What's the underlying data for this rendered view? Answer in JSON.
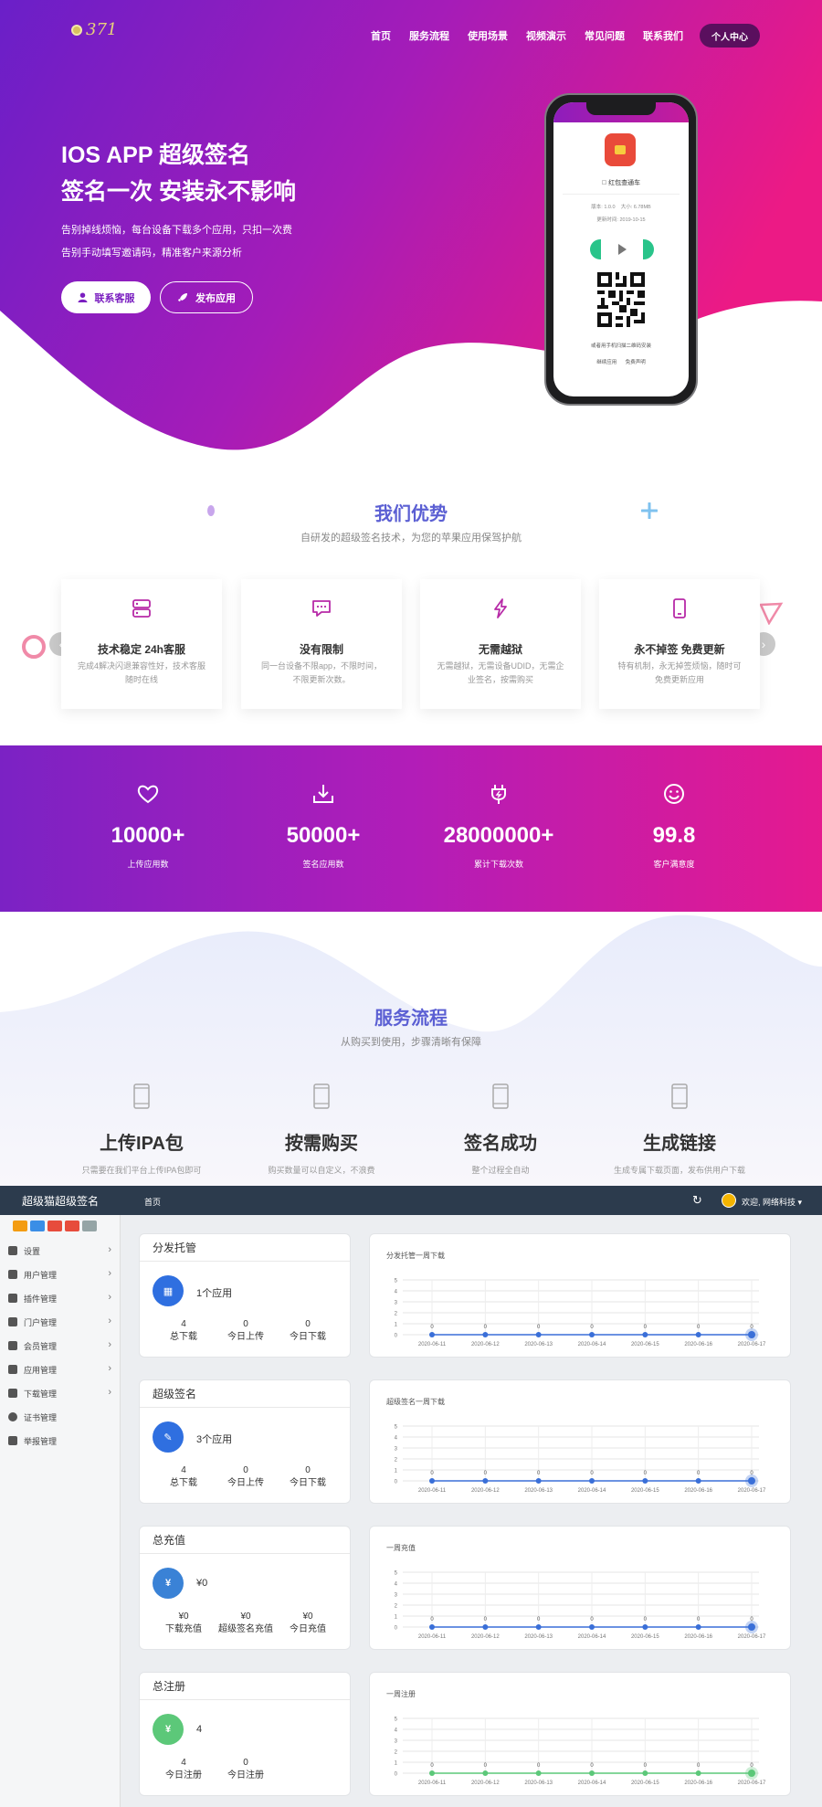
{
  "nav": {
    "logo_text": "371",
    "links": [
      "首页",
      "服务流程",
      "使用场景",
      "视频演示",
      "常见问题",
      "联系我们"
    ],
    "user_center": "个人中心"
  },
  "hero": {
    "title_line1": "IOS APP 超级签名",
    "title_line2": "签名一次 安装永不影响",
    "desc_line1": "告别掉线烦恼，每台设备下载多个应用，只扣一次费",
    "desc_line2": "告别手动填写邀请码，精准客户来源分析",
    "btn_contact": "联系客服",
    "btn_publish": "发布应用"
  },
  "phone": {
    "app_name": "红包查通车",
    "version": "版本: 1.0.0",
    "size": "大小: 6.78MB",
    "updated": "更新时间: 2019-10-15",
    "tip": "或者用手机扫描二维码安装",
    "links": "继续应用 免费声明"
  },
  "advantages": {
    "title": "我们优势",
    "subtitle": "自研发的超级签名技术，为您的苹果应用保驾护航",
    "items": [
      {
        "title": "技术稳定 24h客服",
        "desc": "完成4解决闪退兼容性好，技术客服随时在线"
      },
      {
        "title": "没有限制",
        "desc": "同一台设备不限app，不限时间，不限更新次数。"
      },
      {
        "title": "无需越狱",
        "desc": "无需越狱，无需设备UDID，无需企业签名，按需购买"
      },
      {
        "title": "永不掉签 免费更新",
        "desc": "特有机制，永无掉签烦恼，随时可免费更新应用"
      }
    ]
  },
  "stats": [
    {
      "icon": "heart-icon",
      "value": "10000+",
      "label": "上传应用数"
    },
    {
      "icon": "download-icon",
      "value": "50000+",
      "label": "签名应用数"
    },
    {
      "icon": "plug-icon",
      "value": "28000000+",
      "label": "累计下载次数"
    },
    {
      "icon": "smile-icon",
      "value": "99.8",
      "label": "客户满意度"
    }
  ],
  "flow": {
    "title": "服务流程",
    "subtitle": "从购买到使用，步骤清晰有保障",
    "items": [
      {
        "title": "上传IPA包",
        "desc": "只需要在我们平台上传IPA包即可"
      },
      {
        "title": "按需购买",
        "desc": "购买数量可以自定义，不浪费"
      },
      {
        "title": "签名成功",
        "desc": "整个过程全自动"
      },
      {
        "title": "生成链接",
        "desc": "生成专属下载页面，发布供用户下载"
      }
    ]
  },
  "admin": {
    "brand": "超级猫超级签名",
    "home": "首页",
    "user": "欢迎, 网络科技 ▾",
    "quick_colors": [
      "#f39c12",
      "#3a8ee6",
      "#e74c3c",
      "#e74c3c",
      "#95a5a6"
    ],
    "menu": [
      {
        "label": "设置",
        "icon": "gears-icon",
        "arrow": true
      },
      {
        "label": "用户管理",
        "icon": "users-icon",
        "arrow": true
      },
      {
        "label": "插件管理",
        "icon": "cloud-icon",
        "arrow": true
      },
      {
        "label": "门户管理",
        "icon": "grid-icon",
        "arrow": true
      },
      {
        "label": "会员管理",
        "icon": "move-icon",
        "arrow": true
      },
      {
        "label": "应用管理",
        "icon": "android-icon",
        "arrow": true
      },
      {
        "label": "下载管理",
        "icon": "download-icon",
        "arrow": true
      },
      {
        "label": "证书管理",
        "icon": "dot-icon",
        "arrow": false
      },
      {
        "label": "举报管理",
        "icon": "envelope-icon",
        "arrow": false
      }
    ],
    "cards": [
      {
        "title": "分发托管",
        "icon_color": "#2f6fe0",
        "icon": "calendar-icon",
        "main": "1个应用",
        "cols": [
          {
            "v": "4",
            "l": "总下载"
          },
          {
            "v": "0",
            "l": "今日上传"
          },
          {
            "v": "0",
            "l": "今日下载"
          }
        ]
      },
      {
        "title": "超级签名",
        "icon_color": "#2f6fe0",
        "icon": "pen-icon",
        "main": "3个应用",
        "cols": [
          {
            "v": "4",
            "l": "总下载"
          },
          {
            "v": "0",
            "l": "今日上传"
          },
          {
            "v": "0",
            "l": "今日下载"
          }
        ]
      },
      {
        "title": "总充值",
        "icon_color": "#3a82d6",
        "icon": "yen-icon",
        "main": "¥0",
        "cols": [
          {
            "v": "¥0",
            "l": "下载充值"
          },
          {
            "v": "¥0",
            "l": "超级签名充值"
          },
          {
            "v": "¥0",
            "l": "今日充值"
          }
        ]
      },
      {
        "title": "总注册",
        "icon_color": "#5cc879",
        "icon": "yen-icon",
        "main": "4",
        "cols": [
          {
            "v": "4",
            "l": "今日注册"
          },
          {
            "v": "0",
            "l": "今日注册"
          }
        ]
      }
    ]
  },
  "chart_data": [
    {
      "type": "line",
      "title": "分发托管一周下载",
      "color": "#3a6fd8",
      "categories": [
        "2020-06-11",
        "2020-06-12",
        "2020-06-13",
        "2020-06-14",
        "2020-06-15",
        "2020-06-16",
        "2020-06-17"
      ],
      "values": [
        0,
        0,
        0,
        0,
        0,
        0,
        0
      ],
      "ylim": [
        0,
        5
      ],
      "yticks": [
        0,
        1,
        2,
        3,
        4,
        5
      ],
      "grid": true
    },
    {
      "type": "line",
      "title": "超级签名一周下载",
      "color": "#3a6fd8",
      "categories": [
        "2020-06-11",
        "2020-06-12",
        "2020-06-13",
        "2020-06-14",
        "2020-06-15",
        "2020-06-16",
        "2020-06-17"
      ],
      "values": [
        0,
        0,
        0,
        0,
        0,
        0,
        0
      ],
      "ylim": [
        0,
        5
      ],
      "yticks": [
        0,
        1,
        2,
        3,
        4,
        5
      ],
      "grid": true
    },
    {
      "type": "line",
      "title": "一周充值",
      "color": "#3a6fd8",
      "categories": [
        "2020-06-11",
        "2020-06-12",
        "2020-06-13",
        "2020-06-14",
        "2020-06-15",
        "2020-06-16",
        "2020-06-17"
      ],
      "values": [
        0,
        0,
        0,
        0,
        0,
        0,
        0
      ],
      "ylim": [
        0,
        5
      ],
      "yticks": [
        0,
        1,
        2,
        3,
        4,
        5
      ],
      "grid": true
    },
    {
      "type": "line",
      "title": "一周注册",
      "color": "#5cc879",
      "categories": [
        "2020-06-11",
        "2020-06-12",
        "2020-06-13",
        "2020-06-14",
        "2020-06-15",
        "2020-06-16",
        "2020-06-17"
      ],
      "values": [
        0,
        0,
        0,
        0,
        0,
        0,
        0
      ],
      "ylim": [
        0,
        5
      ],
      "yticks": [
        0,
        1,
        2,
        3,
        4,
        5
      ],
      "grid": true
    }
  ]
}
